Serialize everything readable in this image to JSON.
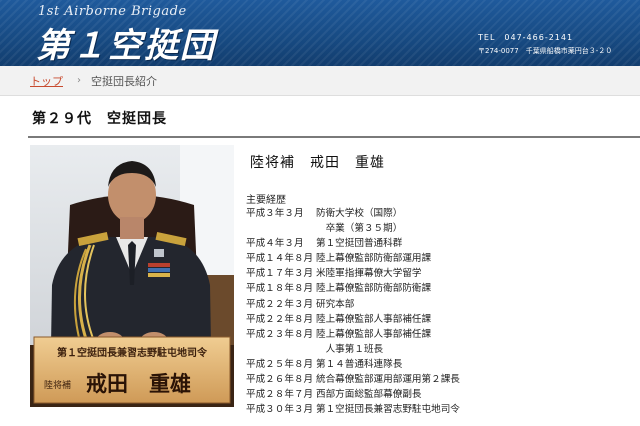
{
  "header": {
    "brand_en": "1st Airborne Brigade",
    "brand_jp": "第１空挺団",
    "tel": "TEL　047-466-2141",
    "address": "〒274-0077　千葉県船橋市薬円台３-２０"
  },
  "breadcrumb": {
    "home": "トップ",
    "separator": "›",
    "current": "空挺団長紹介"
  },
  "page_title": "第２９代　空挺団長",
  "photo": {
    "nameplate_line1": "第１空挺団長兼習志野駐屯地司令",
    "nameplate_rank": "陸将補",
    "nameplate_name": "戒田　重雄"
  },
  "profile": {
    "name": "陸将補　戒田　重雄",
    "career_heading": "主要経歴",
    "career": [
      {
        "date": "平成３年３月",
        "desc": "防衛大学校（国際）"
      },
      {
        "date": "",
        "desc": "　卒業（第３５期）"
      },
      {
        "date": "平成４年３月",
        "desc": "第１空挺団普通科群"
      },
      {
        "date": "平成１４年８月",
        "desc": "陸上幕僚監部防衛部運用課"
      },
      {
        "date": "平成１７年３月",
        "desc": "米陸軍指揮幕僚大学留学"
      },
      {
        "date": "平成１８年８月",
        "desc": "陸上幕僚監部防衛部防衛課"
      },
      {
        "date": "平成２２年３月",
        "desc": "研究本部"
      },
      {
        "date": "平成２２年８月",
        "desc": "陸上幕僚監部人事部補任課"
      },
      {
        "date": "平成２３年８月",
        "desc": "陸上幕僚監部人事部補任課"
      },
      {
        "date": "",
        "desc": "　人事第１班長"
      },
      {
        "date": "平成２５年８月",
        "desc": "第１４普通科連隊長"
      },
      {
        "date": "平成２６年８月",
        "desc": "統合幕僚監部運用部運用第２課長"
      },
      {
        "date": "平成２８年７月",
        "desc": "西部方面総監部幕僚副長"
      },
      {
        "date": "平成３０年３月",
        "desc": "第１空挺団長兼習志野駐屯地司令"
      }
    ]
  },
  "colors": {
    "header_blue": "#1a4b86",
    "link_red": "#c84b2f",
    "uniform_dark": "#23262e",
    "nameplate_wood": "#e3b87a"
  }
}
